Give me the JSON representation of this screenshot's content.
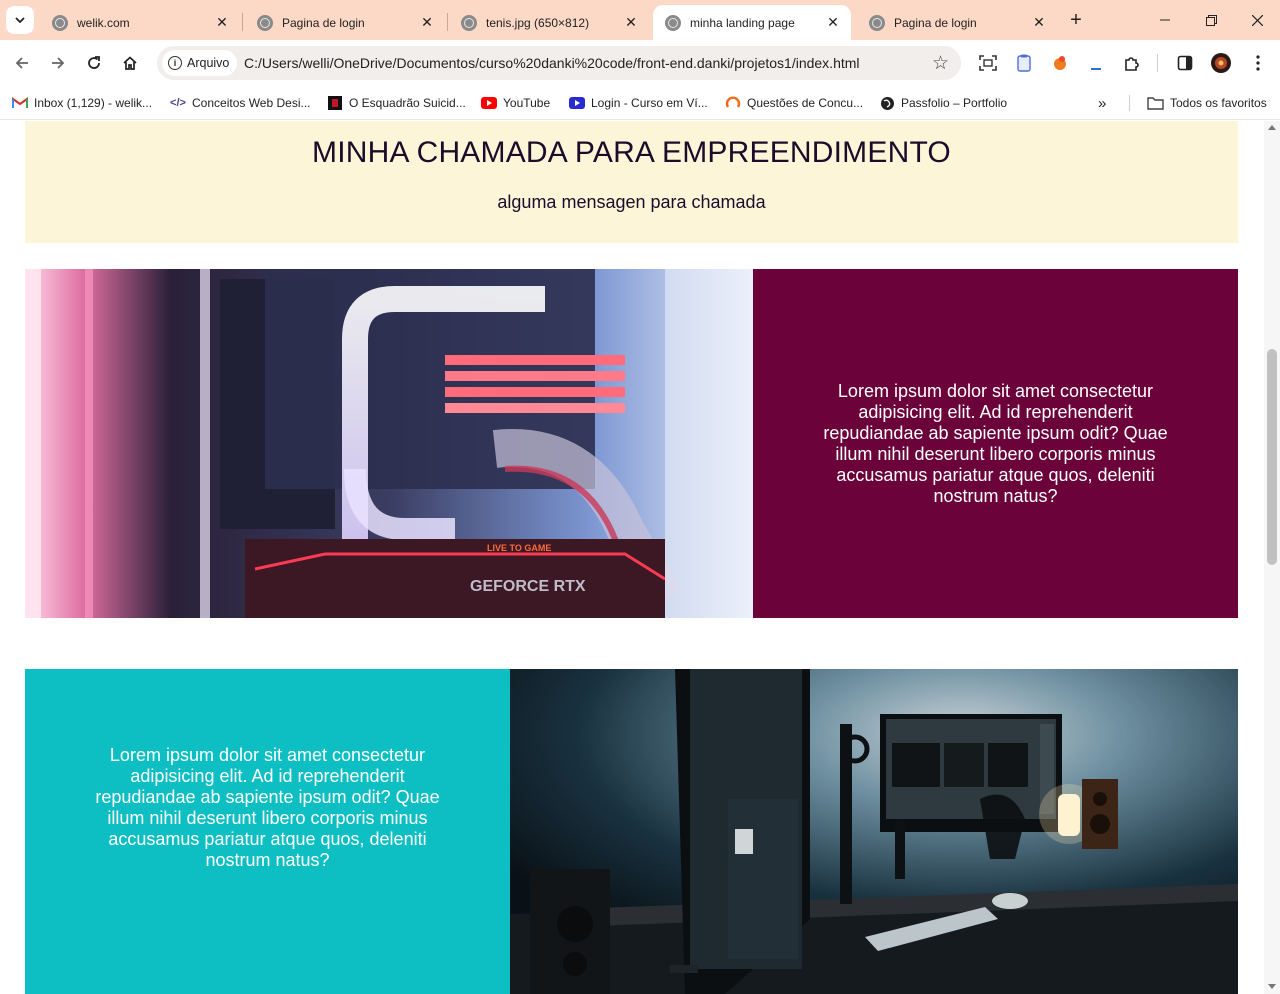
{
  "browser": {
    "tabs": [
      {
        "title": "welik.com",
        "active": false
      },
      {
        "title": "Pagina de login",
        "active": false
      },
      {
        "title": "tenis.jpg (650×812)",
        "active": false
      },
      {
        "title": "minha landing page",
        "active": true
      },
      {
        "title": "Pagina de login",
        "active": false
      }
    ],
    "site_chip": "Arquivo",
    "url": "C:/Users/welli/OneDrive/Documentos/curso%20danki%20code/front-end.danki/projetos1/index.html",
    "bookmarks": [
      {
        "label": "Inbox (1,129) - welik...",
        "icon": "gmail-icon"
      },
      {
        "label": "Conceitos Web Desi...",
        "icon": "code-icon"
      },
      {
        "label": "O Esquadrão Suicid...",
        "icon": "movie-icon"
      },
      {
        "label": "YouTube",
        "icon": "youtube-icon"
      },
      {
        "label": "Login - Curso em Ví...",
        "icon": "curso-icon"
      },
      {
        "label": "Questões de Concu...",
        "icon": "qconcursos-icon"
      },
      {
        "label": "Passfolio – Portfolio",
        "icon": "globe-icon"
      }
    ],
    "all_bookmarks": "Todos os favoritos"
  },
  "page": {
    "cta": {
      "title": "MINHA CHAMADA PARA EMPREENDIMENTO",
      "subtitle": "alguma mensagen para chamada"
    },
    "section1": {
      "image_alt": "pc-water-cooling-image",
      "text": "Lorem ipsum dolor sit amet consectetur adipisicing elit. Ad id reprehenderit repudiandae ab sapiente ipsum odit? Quae illum nihil deserunt libero corporis minus accusamus pariatur atque quos, deleniti nostrum natus?",
      "color": "#6b033a"
    },
    "section2": {
      "image_alt": "desk-setup-image",
      "text": "Lorem ipsum dolor sit amet consectetur adipisicing elit. Ad id reprehenderit repudiandae ab sapiente ipsum odit? Quae illum nihil deserunt libero corporis minus accusamus pariatur atque quos, deleniti nostrum natus?",
      "color": "#0dbfc3"
    },
    "gpu_label": "GEFORCE RTX",
    "gpu_badge": "LIVE TO GAME"
  },
  "colors": {
    "tabstrip": "#fcd9c6",
    "cta_bg": "#fdf5d7",
    "cta_text": "#1d0b2a"
  }
}
